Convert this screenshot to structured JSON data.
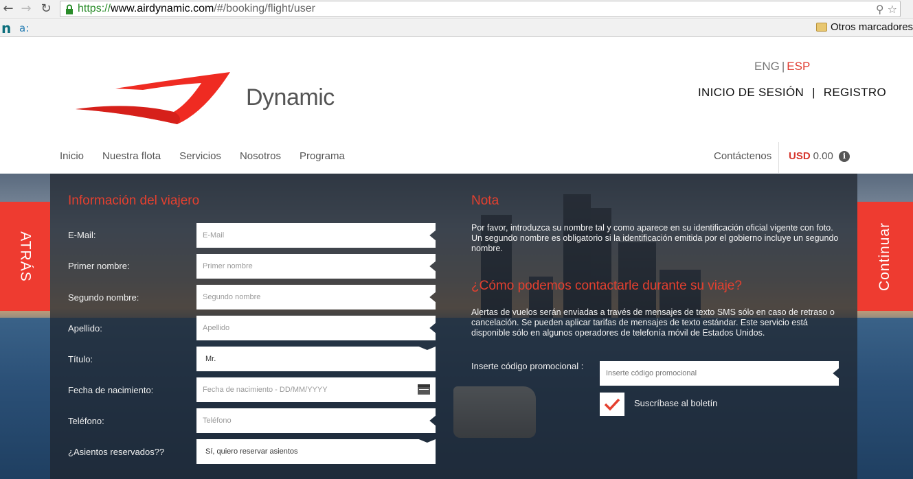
{
  "browser": {
    "url_scheme": "https://",
    "url_domain": "www.airdynamic.com",
    "url_path": "/#/booking/flight/user",
    "bookmark_n": "n",
    "bookmark_a": "a:",
    "bookmark_folder": "Otros marcadores"
  },
  "header": {
    "logo_text": "Dynamic",
    "lang_eng": "ENG",
    "lang_sep": "|",
    "lang_esp": "ESP",
    "login": "INICIO DE SESIÓN",
    "auth_sep": "|",
    "register": "REGISTRO"
  },
  "nav": {
    "items": [
      "Inicio",
      "Nuestra flota",
      "Servicios",
      "Nosotros",
      "Programa"
    ],
    "contact": "Contáctenos",
    "currency": "USD",
    "amount": "0.00",
    "info": "i"
  },
  "side": {
    "back": "ATRÁS",
    "continue": "Continuar"
  },
  "form": {
    "title": "Información del viajero",
    "email": {
      "label": "E-Mail:",
      "placeholder": "E-Mail"
    },
    "first_name": {
      "label": "Primer nombre:",
      "placeholder": "Primer nombre"
    },
    "middle_name": {
      "label": "Segundo nombre:",
      "placeholder": "Segundo nombre"
    },
    "last_name": {
      "label": "Apellido:",
      "placeholder": "Apellido"
    },
    "title_field": {
      "label": "Título:",
      "value": "Mr."
    },
    "birth_date": {
      "label": "Fecha de nacimiento:",
      "placeholder": "Fecha de nacimiento - DD/MM/YYYY"
    },
    "phone": {
      "label": "Teléfono:",
      "placeholder": "Teléfono"
    },
    "seats": {
      "label": "¿Asientos reservados??",
      "value": "Sí, quiero reservar asientos"
    }
  },
  "note": {
    "title": "Nota",
    "text": "Por favor, introduzca su nombre tal y como aparece en su identificación oficial vigente con foto. Un segundo nombre es obligatorio si la identificación emitida por el gobierno incluye un segundo nombre.",
    "contact_title": "¿Cómo podemos contactarle durante su viaje?",
    "contact_text": "Alertas de vuelos serán enviadas a través de mensajes de texto SMS sólo en caso de retraso o cancelación. Se pueden aplicar tarifas de mensajes de texto estándar. Este servicio está disponible sólo en algunos operadores de telefonía móvil de Estados Unidos.",
    "promo_label": "Inserte código promocional :",
    "promo_placeholder": "Inserte código promocional",
    "newsletter": "Suscríbase al boletín"
  },
  "colors": {
    "accent": "#ee3b30",
    "panel": "#1e242d"
  }
}
